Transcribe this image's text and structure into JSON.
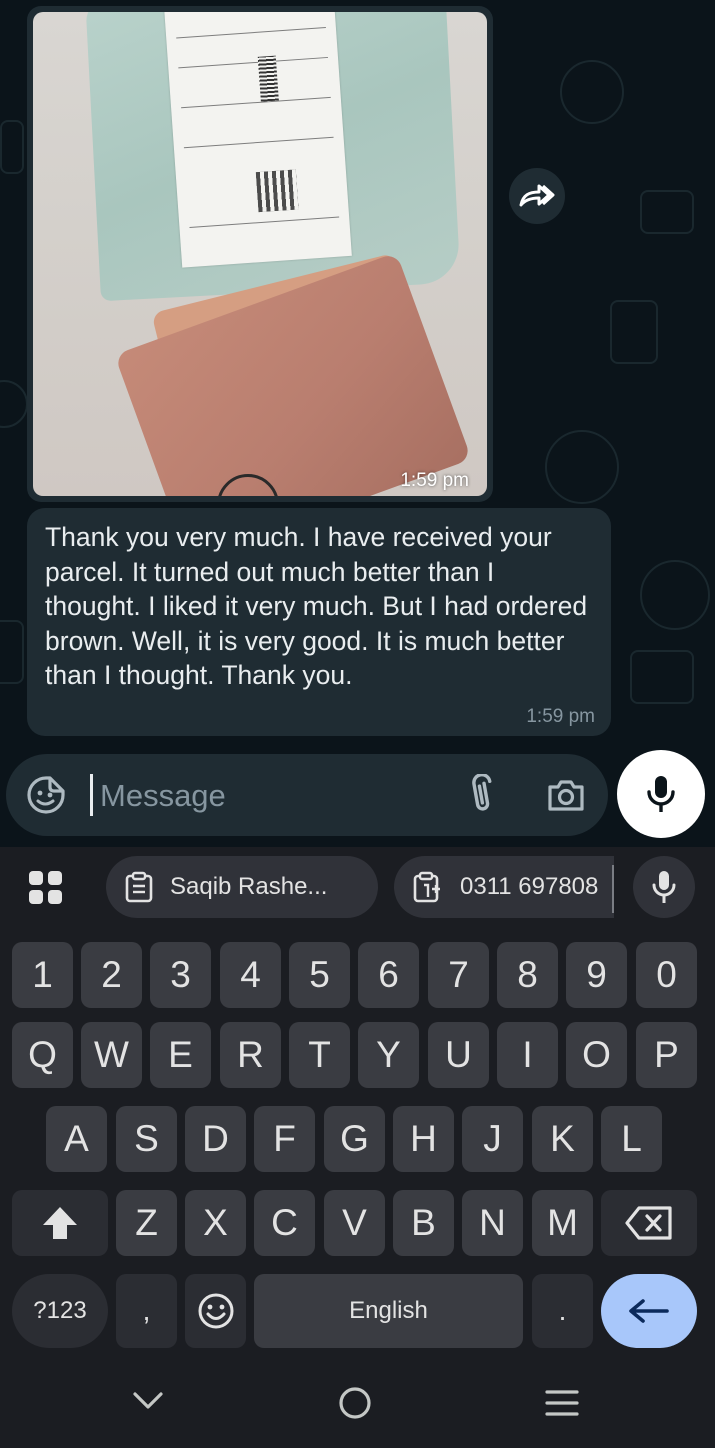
{
  "chat": {
    "image_message": {
      "time": "1:59 pm"
    },
    "text_message": {
      "text": "Thank you very much. I have received your parcel. It turned out much better than I thought. I liked it very much. But I had ordered brown. Well, it is very good. It is much better than I thought. Thank you.",
      "time": "1:59 pm"
    }
  },
  "composer": {
    "placeholder": "Message"
  },
  "keyboard": {
    "suggestions": [
      "Saqib Rashe...",
      "0311 697808"
    ],
    "row_numbers": [
      "1",
      "2",
      "3",
      "4",
      "5",
      "6",
      "7",
      "8",
      "9",
      "0"
    ],
    "row_top": [
      "Q",
      "W",
      "E",
      "R",
      "T",
      "Y",
      "U",
      "I",
      "O",
      "P"
    ],
    "row_middle": [
      "A",
      "S",
      "D",
      "F",
      "G",
      "H",
      "J",
      "K",
      "L"
    ],
    "row_bottom": [
      "Z",
      "X",
      "C",
      "V",
      "B",
      "N",
      "M"
    ],
    "symbols_label": "?123",
    "comma_label": ",",
    "space_label": "English",
    "period_label": "."
  },
  "colors": {
    "chat_background": "#0b141a",
    "bubble": "#1f2c33",
    "keyboard_background": "#1b1d22",
    "key": "#3a3c42",
    "enter_key": "#a8c7fa"
  }
}
